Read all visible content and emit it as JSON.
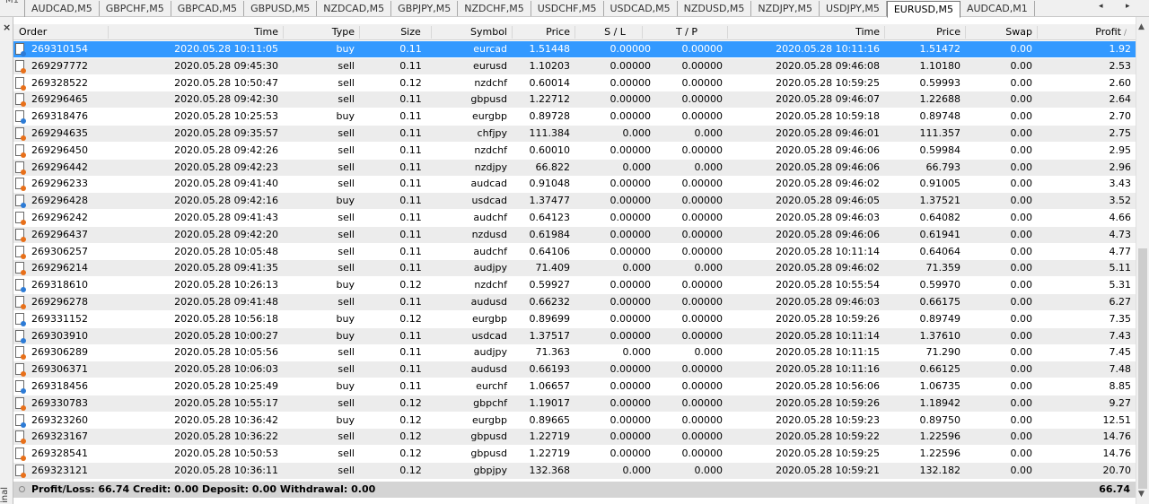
{
  "tabbar": {
    "first_label": "M1",
    "tabs": [
      {
        "label": "AUDCAD,M5",
        "active": false
      },
      {
        "label": "GBPCHF,M5",
        "active": false
      },
      {
        "label": "GBPCAD,M5",
        "active": false
      },
      {
        "label": "GBPUSD,M5",
        "active": false
      },
      {
        "label": "NZDCAD,M5",
        "active": false
      },
      {
        "label": "GBPJPY,M5",
        "active": false
      },
      {
        "label": "NZDCHF,M5",
        "active": false
      },
      {
        "label": "USDCHF,M5",
        "active": false
      },
      {
        "label": "USDCAD,M5",
        "active": false
      },
      {
        "label": "NZDUSD,M5",
        "active": false
      },
      {
        "label": "NZDJPY,M5",
        "active": false
      },
      {
        "label": "USDJPY,M5",
        "active": false
      },
      {
        "label": "EURUSD,M5",
        "active": true
      },
      {
        "label": "AUDCAD,M1",
        "active": false
      }
    ],
    "scroll_left_icon": "arrow-left-icon",
    "scroll_right_icon": "arrow-right-icon"
  },
  "sidebar": {
    "label": "inal",
    "close_glyph": "×"
  },
  "columns": [
    "Order",
    "Time",
    "Type",
    "Size",
    "Symbol",
    "Price",
    "S / L",
    "T / P",
    "Time",
    "Price",
    "Swap",
    "Profit"
  ],
  "sorted_column": "Profit",
  "rows": [
    {
      "order": "269310154",
      "open_time": "2020.05.28 10:11:05",
      "type": "buy",
      "size": "0.11",
      "symbol": "eurcad",
      "open_price": "1.51448",
      "sl": "0.00000",
      "tp": "0.00000",
      "close_time": "2020.05.28 10:11:16",
      "close_price": "1.51472",
      "swap": "0.00",
      "profit": "1.92",
      "selected": true
    },
    {
      "order": "269297772",
      "open_time": "2020.05.28 09:45:30",
      "type": "sell",
      "size": "0.11",
      "symbol": "eurusd",
      "open_price": "1.10203",
      "sl": "0.00000",
      "tp": "0.00000",
      "close_time": "2020.05.28 09:46:08",
      "close_price": "1.10180",
      "swap": "0.00",
      "profit": "2.53"
    },
    {
      "order": "269328522",
      "open_time": "2020.05.28 10:50:47",
      "type": "sell",
      "size": "0.12",
      "symbol": "nzdchf",
      "open_price": "0.60014",
      "sl": "0.00000",
      "tp": "0.00000",
      "close_time": "2020.05.28 10:59:25",
      "close_price": "0.59993",
      "swap": "0.00",
      "profit": "2.60"
    },
    {
      "order": "269296465",
      "open_time": "2020.05.28 09:42:30",
      "type": "sell",
      "size": "0.11",
      "symbol": "gbpusd",
      "open_price": "1.22712",
      "sl": "0.00000",
      "tp": "0.00000",
      "close_time": "2020.05.28 09:46:07",
      "close_price": "1.22688",
      "swap": "0.00",
      "profit": "2.64"
    },
    {
      "order": "269318476",
      "open_time": "2020.05.28 10:25:53",
      "type": "buy",
      "size": "0.11",
      "symbol": "eurgbp",
      "open_price": "0.89728",
      "sl": "0.00000",
      "tp": "0.00000",
      "close_time": "2020.05.28 10:59:18",
      "close_price": "0.89748",
      "swap": "0.00",
      "profit": "2.70"
    },
    {
      "order": "269294635",
      "open_time": "2020.05.28 09:35:57",
      "type": "sell",
      "size": "0.11",
      "symbol": "chfjpy",
      "open_price": "111.384",
      "sl": "0.000",
      "tp": "0.000",
      "close_time": "2020.05.28 09:46:01",
      "close_price": "111.357",
      "swap": "0.00",
      "profit": "2.75"
    },
    {
      "order": "269296450",
      "open_time": "2020.05.28 09:42:26",
      "type": "sell",
      "size": "0.11",
      "symbol": "nzdchf",
      "open_price": "0.60010",
      "sl": "0.00000",
      "tp": "0.00000",
      "close_time": "2020.05.28 09:46:06",
      "close_price": "0.59984",
      "swap": "0.00",
      "profit": "2.95"
    },
    {
      "order": "269296442",
      "open_time": "2020.05.28 09:42:23",
      "type": "sell",
      "size": "0.11",
      "symbol": "nzdjpy",
      "open_price": "66.822",
      "sl": "0.000",
      "tp": "0.000",
      "close_time": "2020.05.28 09:46:06",
      "close_price": "66.793",
      "swap": "0.00",
      "profit": "2.96"
    },
    {
      "order": "269296233",
      "open_time": "2020.05.28 09:41:40",
      "type": "sell",
      "size": "0.11",
      "symbol": "audcad",
      "open_price": "0.91048",
      "sl": "0.00000",
      "tp": "0.00000",
      "close_time": "2020.05.28 09:46:02",
      "close_price": "0.91005",
      "swap": "0.00",
      "profit": "3.43"
    },
    {
      "order": "269296428",
      "open_time": "2020.05.28 09:42:16",
      "type": "buy",
      "size": "0.11",
      "symbol": "usdcad",
      "open_price": "1.37477",
      "sl": "0.00000",
      "tp": "0.00000",
      "close_time": "2020.05.28 09:46:05",
      "close_price": "1.37521",
      "swap": "0.00",
      "profit": "3.52"
    },
    {
      "order": "269296242",
      "open_time": "2020.05.28 09:41:43",
      "type": "sell",
      "size": "0.11",
      "symbol": "audchf",
      "open_price": "0.64123",
      "sl": "0.00000",
      "tp": "0.00000",
      "close_time": "2020.05.28 09:46:03",
      "close_price": "0.64082",
      "swap": "0.00",
      "profit": "4.66"
    },
    {
      "order": "269296437",
      "open_time": "2020.05.28 09:42:20",
      "type": "sell",
      "size": "0.11",
      "symbol": "nzdusd",
      "open_price": "0.61984",
      "sl": "0.00000",
      "tp": "0.00000",
      "close_time": "2020.05.28 09:46:06",
      "close_price": "0.61941",
      "swap": "0.00",
      "profit": "4.73"
    },
    {
      "order": "269306257",
      "open_time": "2020.05.28 10:05:48",
      "type": "sell",
      "size": "0.11",
      "symbol": "audchf",
      "open_price": "0.64106",
      "sl": "0.00000",
      "tp": "0.00000",
      "close_time": "2020.05.28 10:11:14",
      "close_price": "0.64064",
      "swap": "0.00",
      "profit": "4.77"
    },
    {
      "order": "269296214",
      "open_time": "2020.05.28 09:41:35",
      "type": "sell",
      "size": "0.11",
      "symbol": "audjpy",
      "open_price": "71.409",
      "sl": "0.000",
      "tp": "0.000",
      "close_time": "2020.05.28 09:46:02",
      "close_price": "71.359",
      "swap": "0.00",
      "profit": "5.11"
    },
    {
      "order": "269318610",
      "open_time": "2020.05.28 10:26:13",
      "type": "buy",
      "size": "0.12",
      "symbol": "nzdchf",
      "open_price": "0.59927",
      "sl": "0.00000",
      "tp": "0.00000",
      "close_time": "2020.05.28 10:55:54",
      "close_price": "0.59970",
      "swap": "0.00",
      "profit": "5.31"
    },
    {
      "order": "269296278",
      "open_time": "2020.05.28 09:41:48",
      "type": "sell",
      "size": "0.11",
      "symbol": "audusd",
      "open_price": "0.66232",
      "sl": "0.00000",
      "tp": "0.00000",
      "close_time": "2020.05.28 09:46:03",
      "close_price": "0.66175",
      "swap": "0.00",
      "profit": "6.27"
    },
    {
      "order": "269331152",
      "open_time": "2020.05.28 10:56:18",
      "type": "buy",
      "size": "0.12",
      "symbol": "eurgbp",
      "open_price": "0.89699",
      "sl": "0.00000",
      "tp": "0.00000",
      "close_time": "2020.05.28 10:59:26",
      "close_price": "0.89749",
      "swap": "0.00",
      "profit": "7.35"
    },
    {
      "order": "269303910",
      "open_time": "2020.05.28 10:00:27",
      "type": "buy",
      "size": "0.11",
      "symbol": "usdcad",
      "open_price": "1.37517",
      "sl": "0.00000",
      "tp": "0.00000",
      "close_time": "2020.05.28 10:11:14",
      "close_price": "1.37610",
      "swap": "0.00",
      "profit": "7.43"
    },
    {
      "order": "269306289",
      "open_time": "2020.05.28 10:05:56",
      "type": "sell",
      "size": "0.11",
      "symbol": "audjpy",
      "open_price": "71.363",
      "sl": "0.000",
      "tp": "0.000",
      "close_time": "2020.05.28 10:11:15",
      "close_price": "71.290",
      "swap": "0.00",
      "profit": "7.45"
    },
    {
      "order": "269306371",
      "open_time": "2020.05.28 10:06:03",
      "type": "sell",
      "size": "0.11",
      "symbol": "audusd",
      "open_price": "0.66193",
      "sl": "0.00000",
      "tp": "0.00000",
      "close_time": "2020.05.28 10:11:16",
      "close_price": "0.66125",
      "swap": "0.00",
      "profit": "7.48"
    },
    {
      "order": "269318456",
      "open_time": "2020.05.28 10:25:49",
      "type": "buy",
      "size": "0.11",
      "symbol": "eurchf",
      "open_price": "1.06657",
      "sl": "0.00000",
      "tp": "0.00000",
      "close_time": "2020.05.28 10:56:06",
      "close_price": "1.06735",
      "swap": "0.00",
      "profit": "8.85"
    },
    {
      "order": "269330783",
      "open_time": "2020.05.28 10:55:17",
      "type": "sell",
      "size": "0.12",
      "symbol": "gbpchf",
      "open_price": "1.19017",
      "sl": "0.00000",
      "tp": "0.00000",
      "close_time": "2020.05.28 10:59:26",
      "close_price": "1.18942",
      "swap": "0.00",
      "profit": "9.27"
    },
    {
      "order": "269323260",
      "open_time": "2020.05.28 10:36:42",
      "type": "buy",
      "size": "0.12",
      "symbol": "eurgbp",
      "open_price": "0.89665",
      "sl": "0.00000",
      "tp": "0.00000",
      "close_time": "2020.05.28 10:59:23",
      "close_price": "0.89750",
      "swap": "0.00",
      "profit": "12.51"
    },
    {
      "order": "269323167",
      "open_time": "2020.05.28 10:36:22",
      "type": "sell",
      "size": "0.12",
      "symbol": "gbpusd",
      "open_price": "1.22719",
      "sl": "0.00000",
      "tp": "0.00000",
      "close_time": "2020.05.28 10:59:22",
      "close_price": "1.22596",
      "swap": "0.00",
      "profit": "14.76"
    },
    {
      "order": "269328541",
      "open_time": "2020.05.28 10:50:53",
      "type": "sell",
      "size": "0.12",
      "symbol": "gbpusd",
      "open_price": "1.22719",
      "sl": "0.00000",
      "tp": "0.00000",
      "close_time": "2020.05.28 10:59:25",
      "close_price": "1.22596",
      "swap": "0.00",
      "profit": "14.76"
    },
    {
      "order": "269323121",
      "open_time": "2020.05.28 10:36:11",
      "type": "sell",
      "size": "0.12",
      "symbol": "gbpjpy",
      "open_price": "132.368",
      "sl": "0.000",
      "tp": "0.000",
      "close_time": "2020.05.28 10:59:21",
      "close_price": "132.182",
      "swap": "0.00",
      "profit": "20.70"
    }
  ],
  "footer": {
    "summary": "Profit/Loss: 66.74  Credit: 0.00  Deposit: 0.00  Withdrawal: 0.00",
    "total": "66.74"
  },
  "colors": {
    "selected_row": "#3399ff",
    "alt_row": "#ececec",
    "footer_bg": "#d4d4d4",
    "sell_icon": "#e8701a",
    "buy_icon": "#2c7bd6"
  }
}
